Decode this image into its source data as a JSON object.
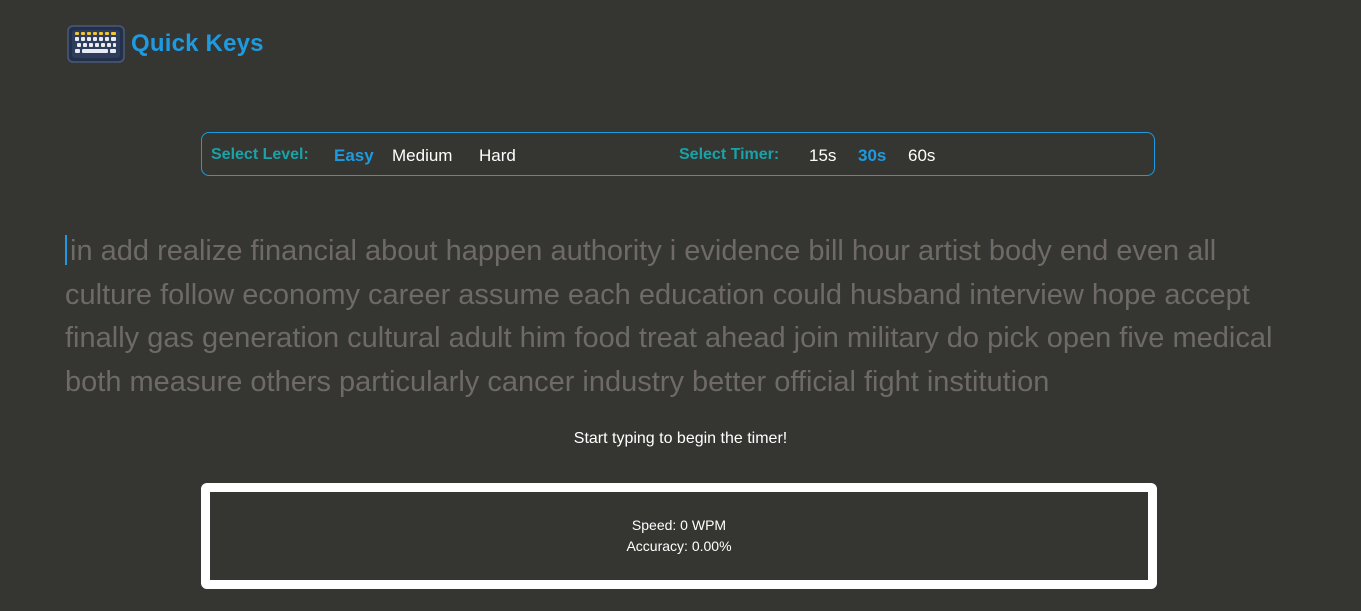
{
  "app": {
    "title": "Quick Keys",
    "logo_icon": "keyboard-icon",
    "accent_color": "#1e9be0",
    "label_color": "#19a2a8"
  },
  "settings": {
    "level_label": "Select Level:",
    "levels": [
      "Easy",
      "Medium",
      "Hard"
    ],
    "selected_level": "Easy",
    "timer_label": "Select Timer:",
    "timers": [
      "15s",
      "30s",
      "60s"
    ],
    "selected_timer": "30s"
  },
  "words": {
    "text": "in add realize financial about happen authority i evidence bill hour artist body end even all culture follow economy career assume each education could husband interview hope accept finally gas generation cultural adult him food treat ahead join military do pick open five medical both measure others particularly cancer industry better official fight institution"
  },
  "hint": "Start typing to begin the timer!",
  "results": {
    "speed": "Speed: 0 WPM",
    "accuracy": "Accuracy: 0.00%"
  }
}
